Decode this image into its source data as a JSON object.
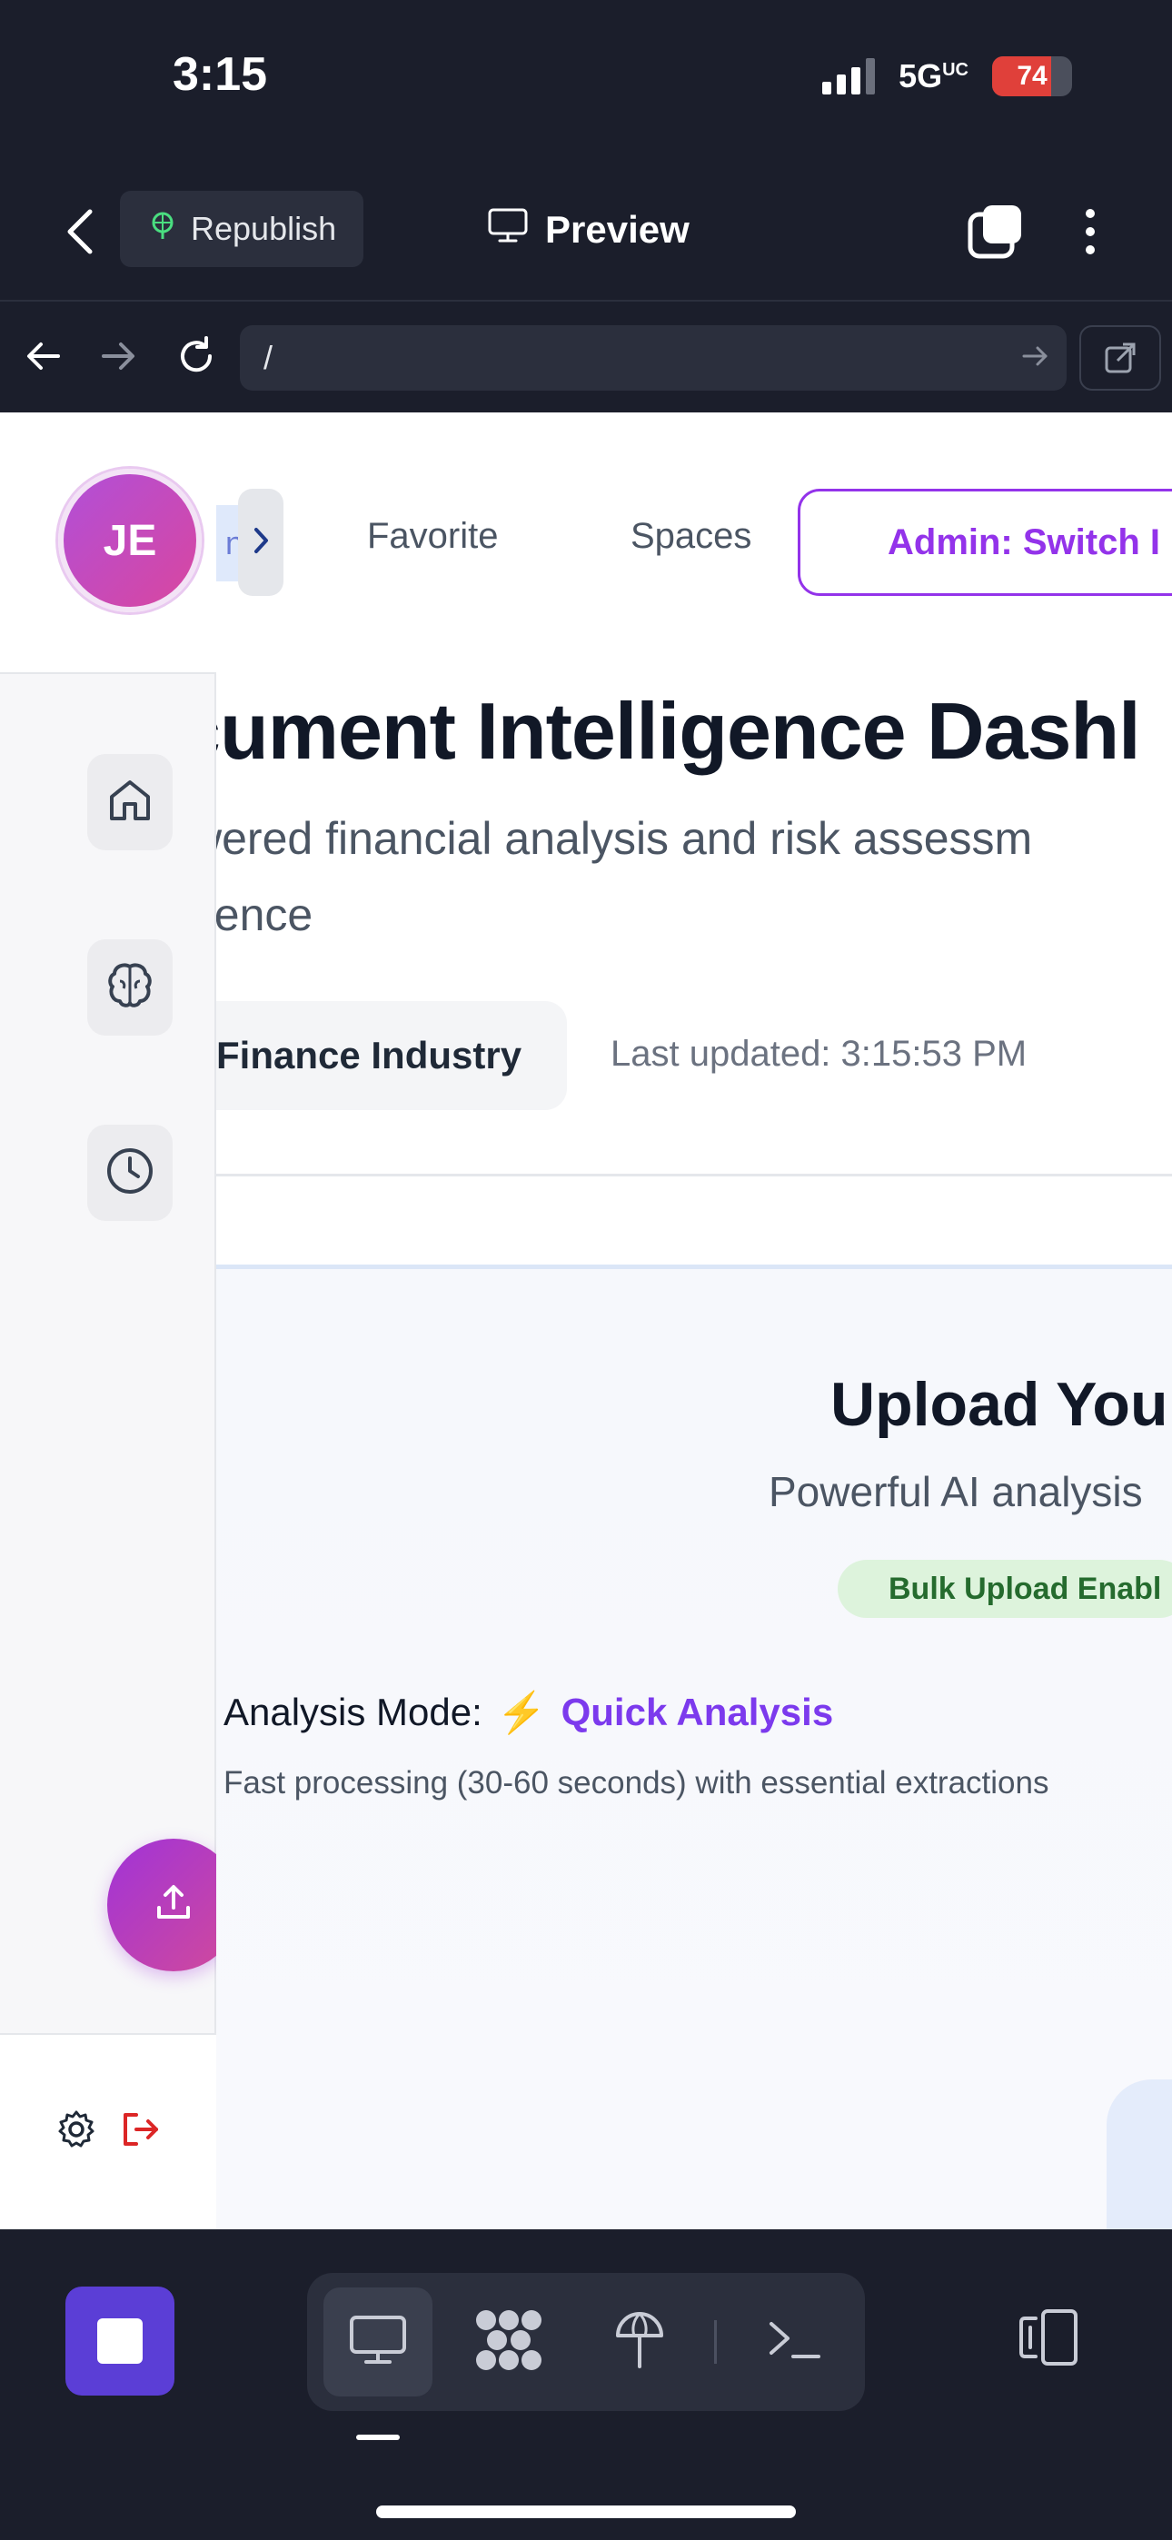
{
  "status_bar": {
    "time": "3:15",
    "network": "5G",
    "network_sup": "UC",
    "battery_level": "74",
    "battery_fraction": 0.74
  },
  "app_header": {
    "back_icon": "chevron-left-icon",
    "republish_label": "Republish",
    "preview_label": "Preview",
    "tabs_icon": "tabs-icon",
    "menu_icon": "more-vertical-icon"
  },
  "browser": {
    "url": "/"
  },
  "sidebar": {
    "avatar_initials": "JE",
    "items": [
      {
        "icon": "home-icon"
      },
      {
        "icon": "brain-icon"
      },
      {
        "icon": "clock-icon"
      }
    ],
    "fab_icon": "upload-icon",
    "footer_icons": [
      "gear-icon",
      "logout-icon"
    ]
  },
  "nav": {
    "partial_label": "nt",
    "tabs": [
      "Favorite",
      "Spaces"
    ],
    "admin_label": "Admin: Switch I"
  },
  "header": {
    "title": "cument Intelligence Dashl",
    "subtitle_line1": "wered financial analysis and risk assessm",
    "subtitle_line2": "gence",
    "industry": "Finance Industry",
    "last_updated": "Last updated: 3:15:53 PM"
  },
  "upload": {
    "title": "Upload You",
    "subtitle": "Powerful AI analysis",
    "bulk_badge": "Bulk Upload Enabl",
    "mode_label": "Analysis Mode:",
    "mode_icon": "⚡",
    "mode_value": "Quick Analysis",
    "mode_description": "Fast processing (30-60 seconds) with essential extractions"
  },
  "dock": {
    "stop_icon": "stop-icon",
    "items": [
      "desktop-icon",
      "apps-grid-icon",
      "deploy-icon",
      "terminal-icon"
    ],
    "devices_icon": "devices-icon"
  },
  "colors": {
    "accent_purple": "#9333ea",
    "mode_purple": "#7c3aed",
    "dark_chrome": "#1b1e2b",
    "bulk_green_bg": "#ddf3dc",
    "bulk_green_text": "#256b2e"
  }
}
